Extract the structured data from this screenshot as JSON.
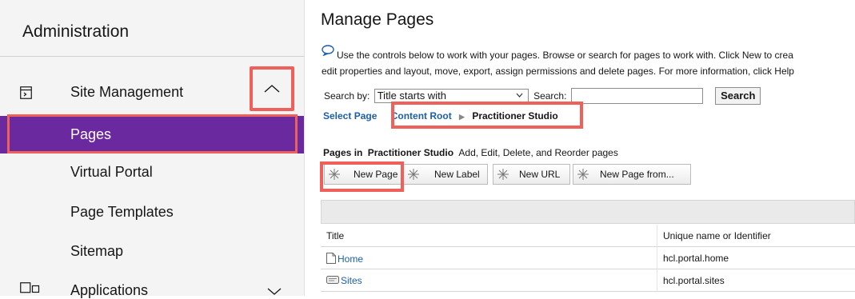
{
  "sidebar": {
    "title": "Administration",
    "section": {
      "label": "Site Management",
      "icon": "site-management-icon",
      "expanded": true
    },
    "items": [
      {
        "label": "Pages",
        "active": true
      },
      {
        "label": "Virtual Portal",
        "active": false
      },
      {
        "label": "Page Templates",
        "active": false
      },
      {
        "label": "Sitemap",
        "active": false
      }
    ],
    "applications": {
      "label": "Applications",
      "icon": "applications-icon"
    },
    "active_color": "#6b29a0",
    "highlight_color": "#f0605a"
  },
  "main": {
    "title": "Manage Pages",
    "intro_line1": "Use the controls below to work with your pages. Browse or search for pages to work with. Click New to crea",
    "intro_line2": "edit properties and layout, move, export, assign permissions and delete pages. For more information, click Help",
    "search": {
      "by_label": "Search by:",
      "by_value": "Title starts with",
      "search_label": "Search:",
      "input_value": "",
      "button_label": "Search"
    },
    "breadcrumb": {
      "select_page": "Select Page",
      "content_root": "Content Root",
      "current": "Practitioner Studio"
    },
    "pages_in": {
      "prefix": "Pages in",
      "name": "Practitioner Studio",
      "suffix": "Add, Edit, Delete, and Reorder pages"
    },
    "toolbar": {
      "new_page": "New Page",
      "new_label": "New Label",
      "new_url": "New URL",
      "new_page_from": "New Page from..."
    },
    "table": {
      "headers": [
        "Title",
        "Unique name or Identifier"
      ],
      "rows": [
        {
          "title": "Home",
          "icon": "page-icon",
          "identifier": "hcl.portal.home"
        },
        {
          "title": "Sites",
          "icon": "label-icon",
          "identifier": "hcl.portal.sites"
        }
      ]
    }
  }
}
